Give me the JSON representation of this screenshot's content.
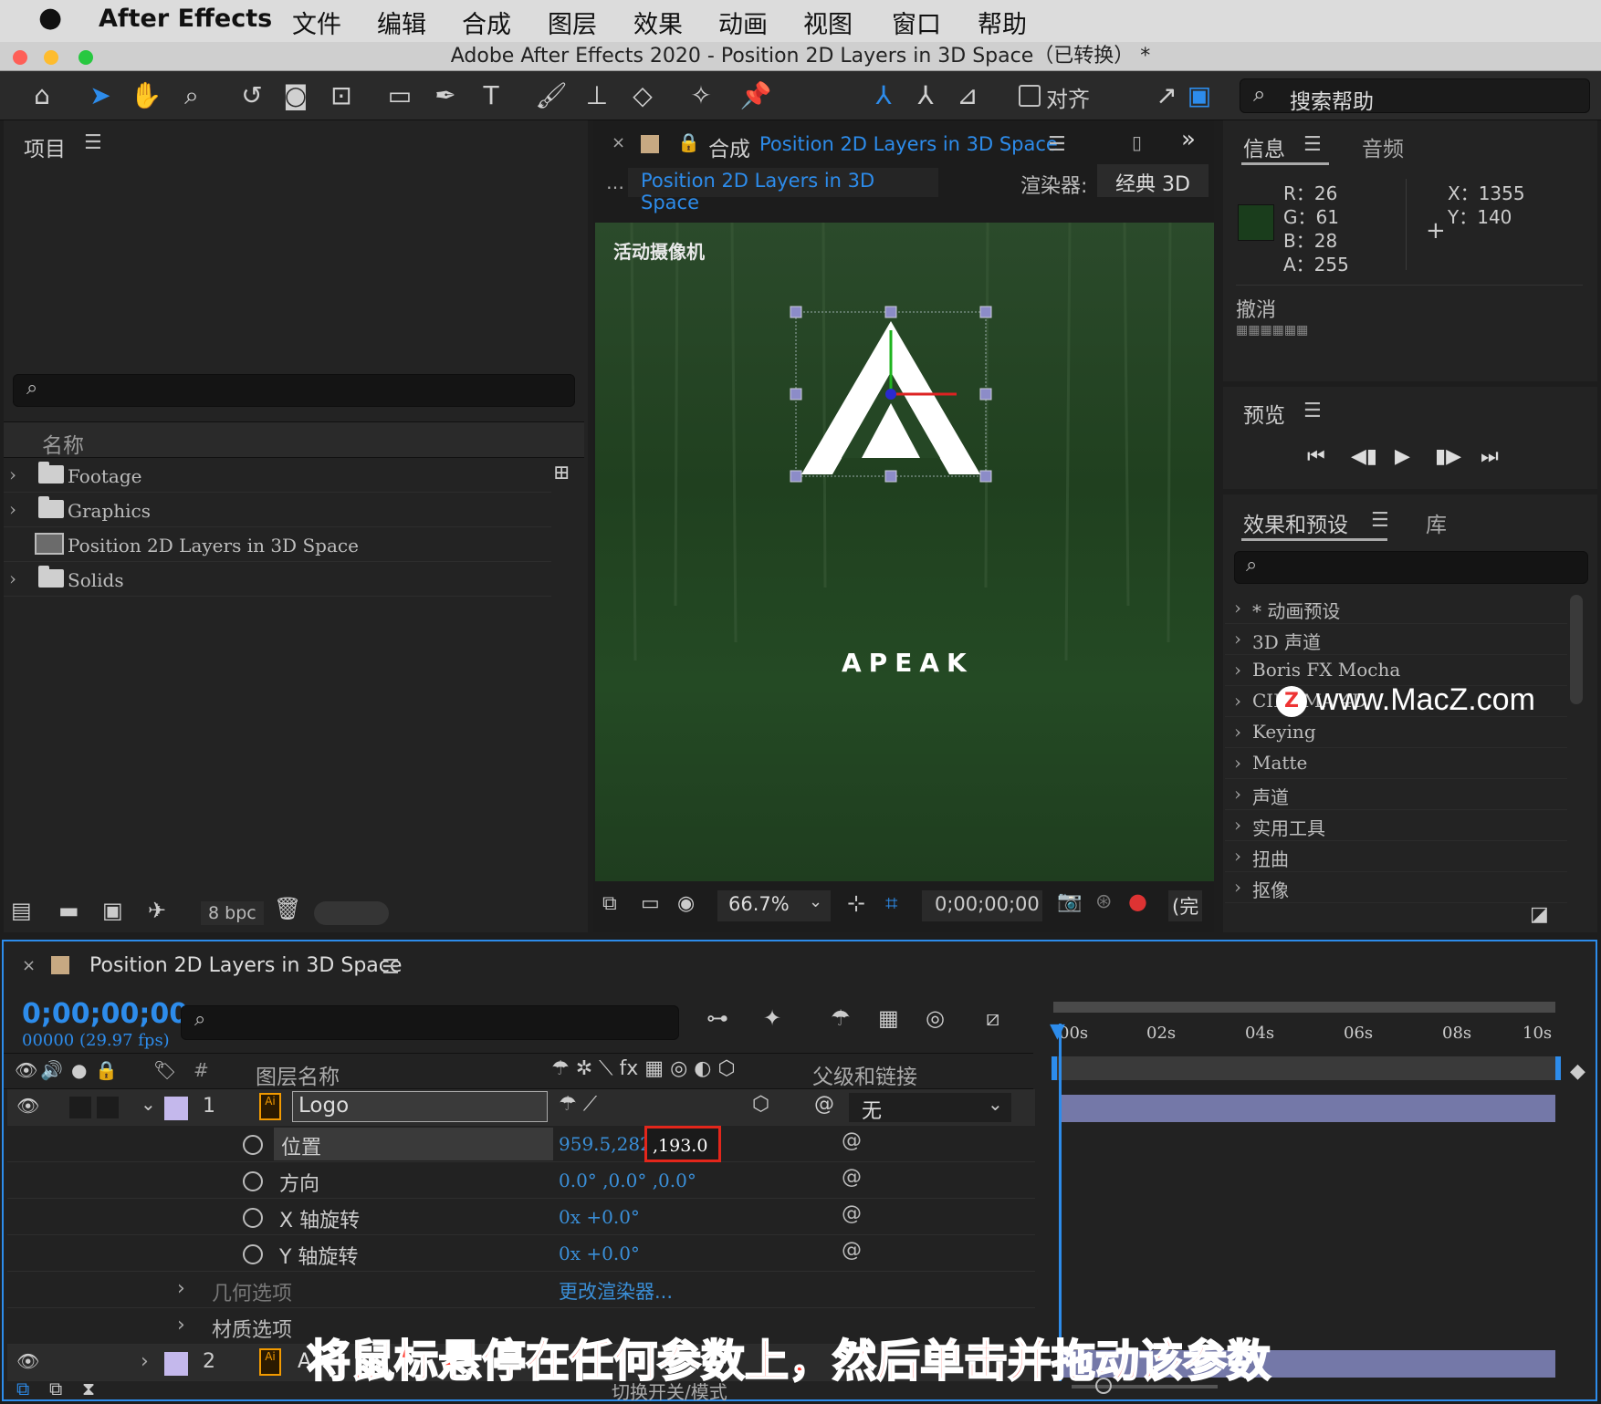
{
  "menubar": {
    "app": "After Effects",
    "items": [
      "文件",
      "编辑",
      "合成",
      "图层",
      "效果",
      "动画",
      "视图",
      "窗口",
      "帮助"
    ]
  },
  "window": {
    "title": "Adobe After Effects 2020 - Position 2D Layers in 3D Space（已转换） *"
  },
  "toolbar": {
    "align_label": "对齐",
    "search_help": "搜索帮助"
  },
  "project": {
    "tab": "项目",
    "col_name": "名称",
    "items": [
      {
        "name": "Footage",
        "type": "folder"
      },
      {
        "name": "Graphics",
        "type": "folder"
      },
      {
        "name": "Position 2D Layers in 3D Space",
        "type": "comp"
      },
      {
        "name": "Solids",
        "type": "folder"
      }
    ],
    "bpc": "8 bpc"
  },
  "composition": {
    "tab_prefix": "合成",
    "tab_name": "Position 2D Layers in 3D Space",
    "crumb": "Position 2D Layers in 3D Space",
    "renderer_label": "渲染器:",
    "renderer": "经典 3D",
    "camera_label": "活动摄像机",
    "logo_text": "APEAK",
    "zoom": "66.7%",
    "timecode": "0;00;00;00",
    "res": "(完"
  },
  "info": {
    "tab": "信息",
    "tab2": "音频",
    "r": "R：26",
    "g": "G：61",
    "b": "B：28",
    "a": "A：255",
    "x": "X：1355",
    "y": "Y：140",
    "swatch": "#1a3d1c",
    "undo": "撤消"
  },
  "preview": {
    "tab": "预览"
  },
  "effects": {
    "tab": "效果和预设",
    "tab2": "库",
    "items": [
      "* 动画预设",
      "3D 声道",
      "Boris FX Mocha",
      "CINEMA 4D",
      "Keying",
      "Matte",
      "声道",
      "实用工具",
      "扭曲",
      "抠像"
    ]
  },
  "watermark": "www.MacZ.com",
  "timeline": {
    "tab": "Position 2D Layers in 3D Space",
    "timecode": "0;00;00;00",
    "fps": "00000 (29.97 fps)",
    "col_layer": "图层名称",
    "col_parent": "父级和链接",
    "ticks": [
      "00s",
      "02s",
      "04s",
      "06s",
      "08s",
      "10s"
    ],
    "layer1": {
      "num": "1",
      "name": "Logo",
      "parent": "无"
    },
    "props": [
      {
        "name": "位置",
        "value": "959.5,282.",
        "highlight": ",193.0"
      },
      {
        "name": "方向",
        "value": "0.0° ,0.0° ,0.0°"
      },
      {
        "name": "X 轴旋转",
        "value": "0x +0.0°"
      },
      {
        "name": "Y 轴旋转",
        "value": "0x +0.0°"
      }
    ],
    "geom": "几何选项",
    "change_renderer": "更改渲染器...",
    "material": "材质选项",
    "layer2": {
      "num": "2",
      "name": "A"
    },
    "switch_mode": "切换开关/模式"
  },
  "caption": "将鼠标悬停在任何参数上，然后单击并拖动该参数",
  "colors": {
    "accent": "#2d8ceb",
    "highlight_box": "#e3261b",
    "caption": "#ff3b2f"
  }
}
